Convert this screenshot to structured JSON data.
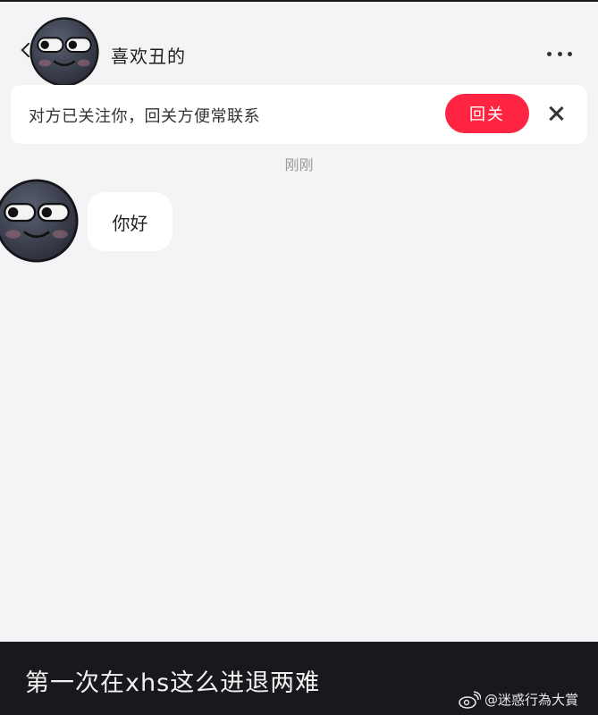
{
  "header": {
    "contact_name": "喜欢丑的",
    "back_icon": "chevron-left-icon",
    "more_icon": "more-horizontal-icon"
  },
  "follow_banner": {
    "text": "对方已关注你，回关方便常联系",
    "follow_back_label": "回关",
    "close_icon": "close-icon",
    "accent_color": "#ff2442"
  },
  "chat": {
    "timestamp": "刚刚",
    "messages": [
      {
        "sender": "contact",
        "text": "你好"
      }
    ]
  },
  "caption": {
    "text": "第一次在xhs这么进退两难",
    "watermark": "@迷惑行為大賞",
    "watermark_icon": "weibo-icon"
  }
}
